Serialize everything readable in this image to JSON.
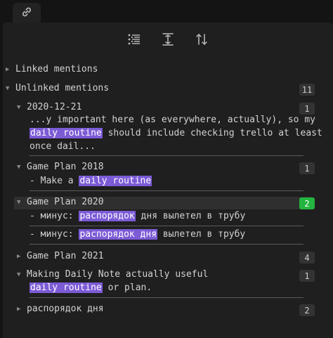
{
  "tab": {
    "icon": "link-icon"
  },
  "toolbar": {
    "icons": [
      "list-icon",
      "expand-collapse-icon",
      "sort-icon"
    ]
  },
  "linked": {
    "label": "Linked mentions"
  },
  "unlinked": {
    "label": "Unlinked mentions",
    "count": "11"
  },
  "groups": [
    {
      "title": "2020-12-21",
      "count": "1",
      "line1_pre": "...y important here (as everywhere, actually), so my",
      "line2_hl": "daily routine",
      "line2_post": " should include checking trello at least",
      "line3": "once dail..."
    },
    {
      "title": "Game Plan 2018",
      "count": "1",
      "pre": "- Make a ",
      "hl": "daily routine"
    },
    {
      "title": "Game Plan 2020",
      "count": "2",
      "m1_pre": "- минус: ",
      "m1_hl": "распорядок",
      "m1_post": " дня вылетел в трубу",
      "m2_pre": "- минус: ",
      "m2_hl": "распорядок дня",
      "m2_post": " вылетел в трубу"
    },
    {
      "title": "Game Plan 2021",
      "count": "4"
    },
    {
      "title": "Making Daily Note actually useful",
      "count": "1",
      "hl": "daily routine",
      "post": " or plan."
    },
    {
      "title": "распорядок дня",
      "count": "2"
    }
  ],
  "colors": {
    "highlight": "#7c5bd6",
    "active_count": "#23b53f"
  }
}
